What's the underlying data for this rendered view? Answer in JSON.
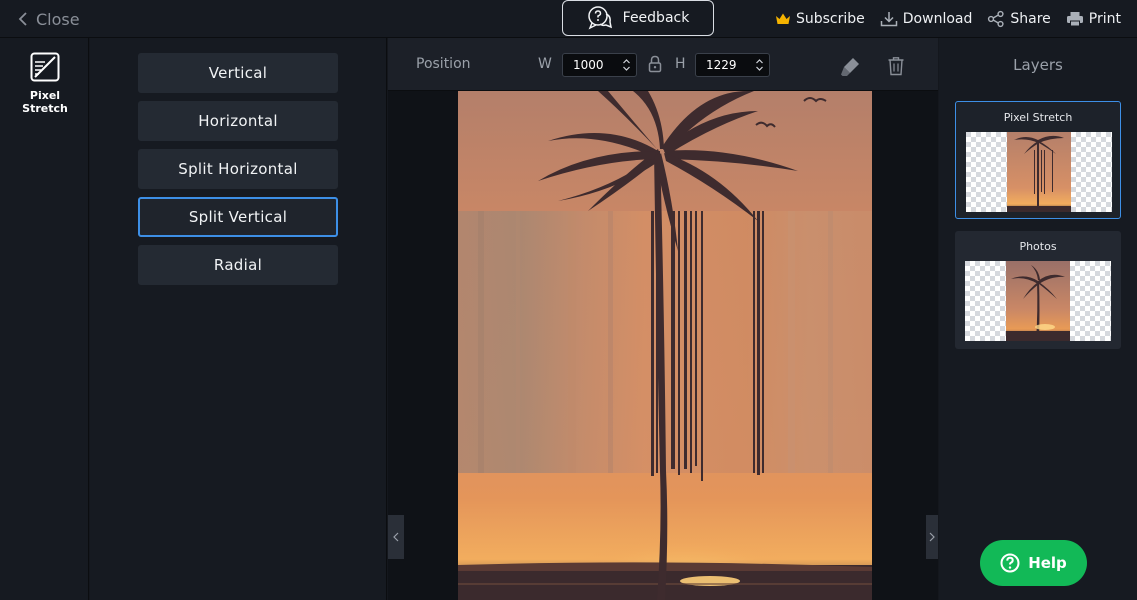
{
  "topbar": {
    "close_label": "Close",
    "feedback_label": "Feedback",
    "actions": [
      "Subscribe",
      "Download",
      "Share",
      "Print"
    ],
    "subscribe_icon_color": "#f5b300"
  },
  "left_rail": {
    "tool_label": "Pixel Stretch"
  },
  "options": {
    "items": [
      "Vertical",
      "Horizontal",
      "Split Horizontal",
      "Split Vertical",
      "Radial"
    ],
    "selected": "Split Vertical",
    "accent": "#3d8fe6"
  },
  "position_bar": {
    "label": "Position",
    "w_label": "W",
    "w_value": "1000",
    "h_label": "H",
    "h_value": "1229"
  },
  "layers": {
    "title": "Layers",
    "items": [
      "Pixel Stretch",
      "Photos"
    ],
    "active": "Pixel Stretch"
  },
  "help": {
    "label": "Help",
    "color": "#12b957"
  }
}
